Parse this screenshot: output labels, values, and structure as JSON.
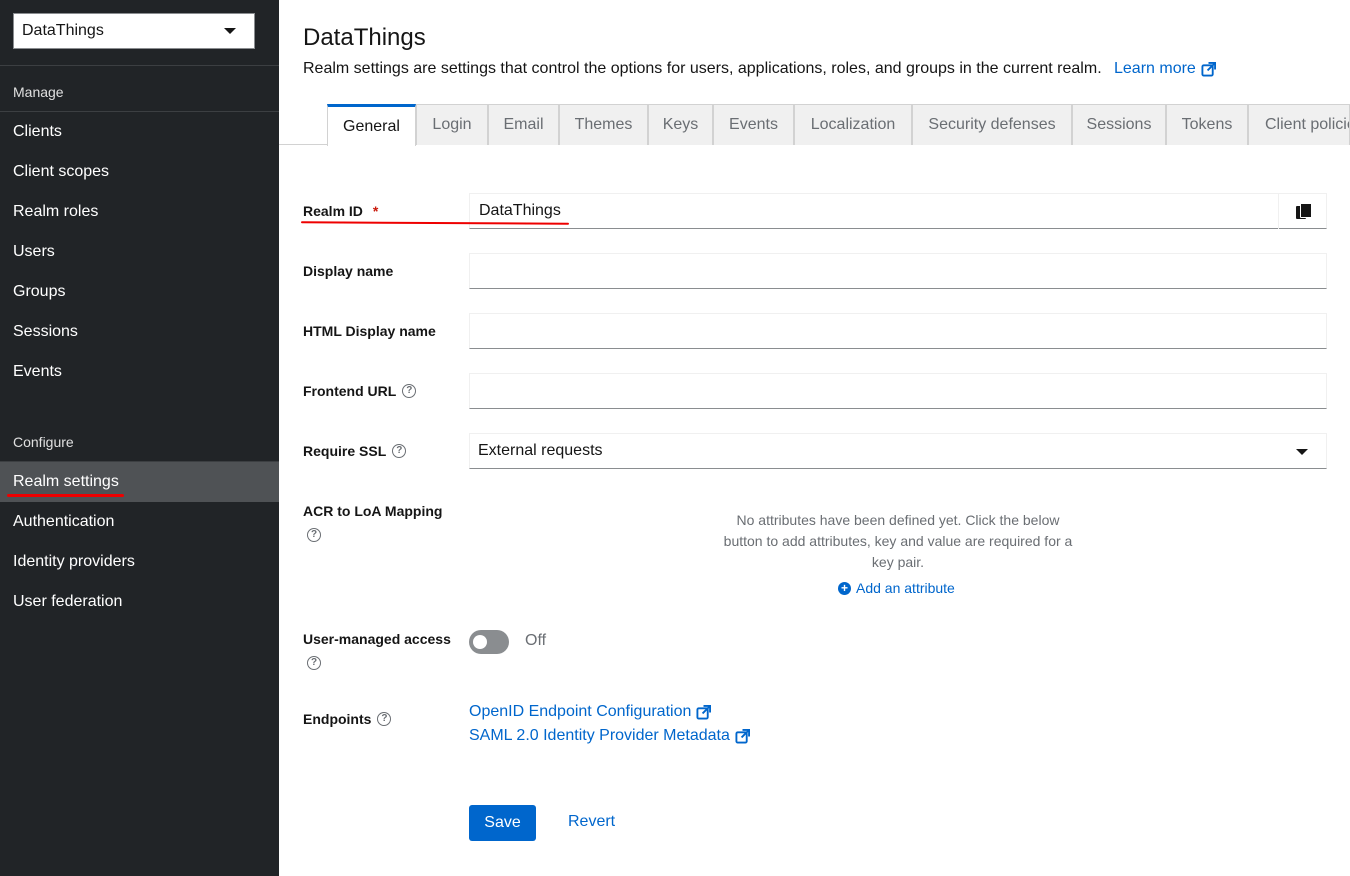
{
  "sidebar": {
    "realm_selector": "DataThings",
    "sections": {
      "manage": "Manage",
      "configure": "Configure"
    },
    "manage_items": [
      "Clients",
      "Client scopes",
      "Realm roles",
      "Users",
      "Groups",
      "Sessions",
      "Events"
    ],
    "configure_items": [
      "Realm settings",
      "Authentication",
      "Identity providers",
      "User federation"
    ],
    "active_item": "Realm settings"
  },
  "header": {
    "title": "DataThings",
    "description": "Realm settings are settings that control the options for users, applications, roles, and groups in the current realm.",
    "learn_more": "Learn more"
  },
  "tabs": [
    "General",
    "Login",
    "Email",
    "Themes",
    "Keys",
    "Events",
    "Localization",
    "Security defenses",
    "Sessions",
    "Tokens",
    "Client policies"
  ],
  "active_tab": "General",
  "form": {
    "realm_id": {
      "label": "Realm ID",
      "required": "*",
      "value": "DataThings"
    },
    "display_name": {
      "label": "Display name",
      "value": ""
    },
    "html_display_name": {
      "label": "HTML Display name",
      "value": ""
    },
    "frontend_url": {
      "label": "Frontend URL",
      "value": ""
    },
    "require_ssl": {
      "label": "Require SSL",
      "value": "External requests"
    },
    "acr_loa": {
      "label": "ACR to LoA Mapping",
      "empty_text": "No attributes have been defined yet. Click the below button to add attributes, key and value are required for a key pair.",
      "add_label": "Add an attribute"
    },
    "user_managed_access": {
      "label": "User-managed access",
      "state": "Off"
    },
    "endpoints": {
      "label": "Endpoints",
      "links": [
        "OpenID Endpoint Configuration",
        "SAML 2.0 Identity Provider Metadata"
      ]
    }
  },
  "actions": {
    "save": "Save",
    "revert": "Revert"
  },
  "colors": {
    "accent": "#0066cc",
    "sidebar_bg": "#212427",
    "annotation_red": "#ee0000"
  }
}
